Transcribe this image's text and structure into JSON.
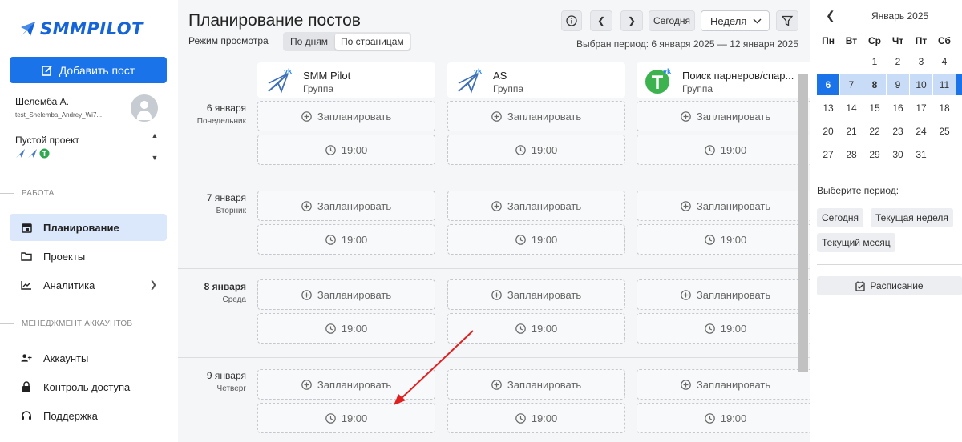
{
  "sidebar": {
    "logo_text": "SMMPILOT",
    "add_post_label": "Добавить пост",
    "user_name": "Шелемба А.",
    "user_login": "test_Shelemba_Andrey_Wi7...",
    "project_name": "Пустой проект",
    "section_work": "РАБОТА",
    "section_accounts": "МЕНЕДЖМЕНТ АККАУНТОВ",
    "nav": [
      {
        "label": "Планирование",
        "icon": "calendar-icon",
        "active": true
      },
      {
        "label": "Проекты",
        "icon": "folder-icon"
      },
      {
        "label": "Аналитика",
        "icon": "chart-icon",
        "has_submenu": true
      },
      {
        "label": "Аккаунты",
        "icon": "add-user-icon"
      },
      {
        "label": "Контроль доступа",
        "icon": "lock-icon"
      },
      {
        "label": "Поддержка",
        "icon": "headset-icon"
      }
    ]
  },
  "main": {
    "title": "Планирование постов",
    "view_mode_label": "Режим просмотра",
    "view_modes": [
      "По дням",
      "По страницам"
    ],
    "active_view_mode": "По страницам",
    "today_label": "Сегодня",
    "range_select": "Неделя",
    "period_text": "Выбран период: 6 января 2025 — 12 января 2025",
    "channels": [
      {
        "name": "SMM Pilot",
        "type": "Группа",
        "icon": "paper-plane-icon"
      },
      {
        "name": "AS",
        "type": "Группа",
        "icon": "paper-plane-icon"
      },
      {
        "name": "Поиск парнеров/спар...",
        "type": "Группа",
        "icon": "green-t-icon"
      }
    ],
    "days": [
      {
        "date": "6 января",
        "weekday": "Понедельник",
        "bold": false
      },
      {
        "date": "7 января",
        "weekday": "Вторник",
        "bold": false
      },
      {
        "date": "8 января",
        "weekday": "Среда",
        "bold": true
      },
      {
        "date": "9 января",
        "weekday": "Четверг",
        "bold": false
      }
    ],
    "schedule_label": "Запланировать",
    "time_label": "19:00"
  },
  "calendar": {
    "month": "Январь 2025",
    "weekdays": [
      "Пн",
      "Вт",
      "Ср",
      "Чт",
      "Пт",
      "Сб"
    ],
    "weeks": [
      [
        "",
        "",
        "1",
        "2",
        "3",
        "4"
      ],
      [
        "6",
        "7",
        "8",
        "9",
        "10",
        "11"
      ],
      [
        "13",
        "14",
        "15",
        "16",
        "17",
        "18"
      ],
      [
        "20",
        "21",
        "22",
        "23",
        "24",
        "25"
      ],
      [
        "27",
        "28",
        "29",
        "30",
        "31",
        ""
      ]
    ],
    "selected_start": "6",
    "today": "8",
    "pick_label": "Выберите период:",
    "presets": [
      "Сегодня",
      "Текущая неделя",
      "Текущий месяц"
    ],
    "schedule_button": "Расписание"
  },
  "colors": {
    "accent": "#1a73e8",
    "range": "#c8dcf7",
    "arrow": "#e02020"
  }
}
